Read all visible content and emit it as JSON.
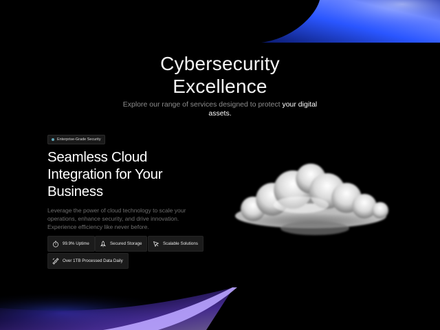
{
  "hero": {
    "title_line1": "Cybersecurity",
    "title_line2": "Excellence",
    "subtitle_plain": "Explore our range of services designed to protect ",
    "subtitle_highlight": "your digital assets."
  },
  "feature": {
    "badge": "Enterprise-Grade Security",
    "title_line1": "Seamless Cloud",
    "title_line2": "Integration for Your",
    "title_line3": "Business",
    "description": "Leverage the power of cloud technology to scale your operations, enhance security, and drive innovation. Experience efficiency like never before.",
    "chips": [
      {
        "label": "99.9% Uptime",
        "icon": "stopwatch-icon"
      },
      {
        "label": "Secured Storage",
        "icon": "rocket-icon"
      },
      {
        "label": "Scalable Solutions",
        "icon": "cursor-pointer-icon"
      },
      {
        "label": "Over 1TB Processed Data Daily",
        "icon": "satellite-icon"
      }
    ]
  },
  "colors": {
    "background": "#000000",
    "glow_blue": "#2c5bff",
    "glow_violet": "#7b4dff",
    "badge_dot": "#5fa7b8"
  }
}
